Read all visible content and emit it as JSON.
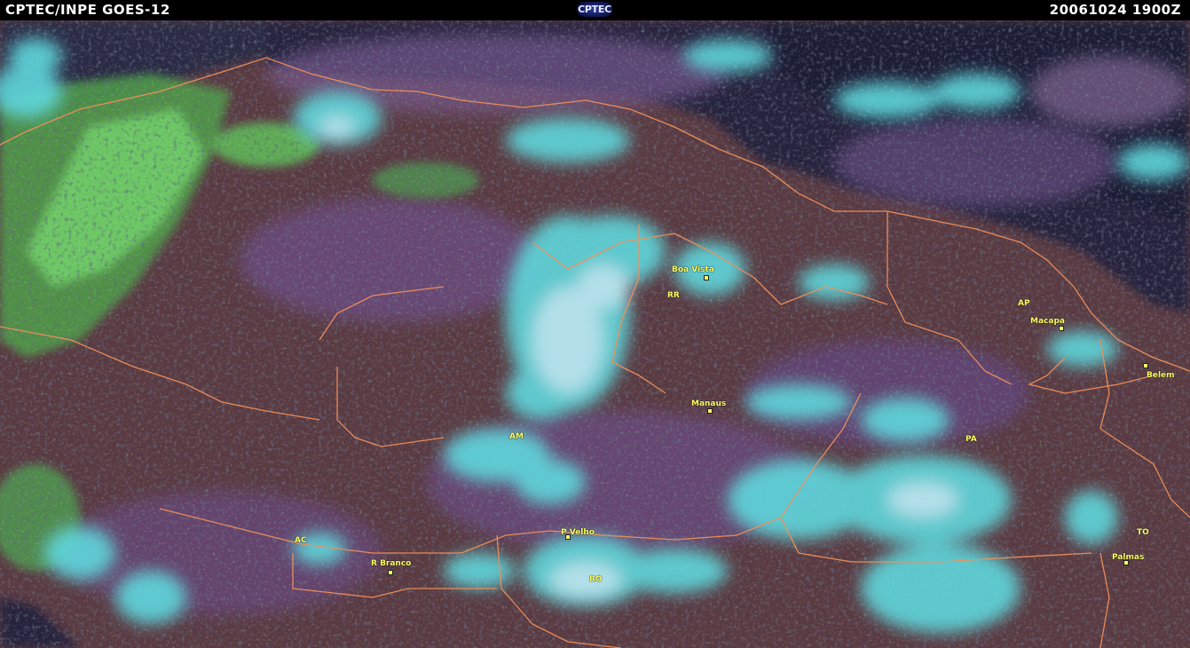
{
  "header": {
    "title": "CPTEC/INPE  GOES-12",
    "logo_text": "CPTEC",
    "datetime": "20061024  1900Z"
  },
  "colors": {
    "bar": "#000000",
    "land": "#5a3a42",
    "ocean": "#24223a",
    "cloud": "#6ee8e2",
    "vegetation": "#6fe06a",
    "borders": "#f0905a",
    "labels": "#ffff66"
  },
  "map": {
    "states": [
      {
        "id": "rr",
        "text": "RR"
      },
      {
        "id": "ap",
        "text": "AP"
      },
      {
        "id": "am",
        "text": "AM"
      },
      {
        "id": "pa",
        "text": "PA"
      },
      {
        "id": "ac",
        "text": "AC"
      },
      {
        "id": "ro",
        "text": "RO"
      },
      {
        "id": "to",
        "text": "TO"
      }
    ],
    "cities": [
      {
        "id": "boa-vista",
        "text": "Boa Vista"
      },
      {
        "id": "macapa",
        "text": "Macapa"
      },
      {
        "id": "belem",
        "text": "Belem"
      },
      {
        "id": "manaus",
        "text": "Manaus"
      },
      {
        "id": "p-velho",
        "text": "P Velho"
      },
      {
        "id": "r-branco",
        "text": "R Branco"
      },
      {
        "id": "palmas",
        "text": "Palmas"
      }
    ]
  }
}
